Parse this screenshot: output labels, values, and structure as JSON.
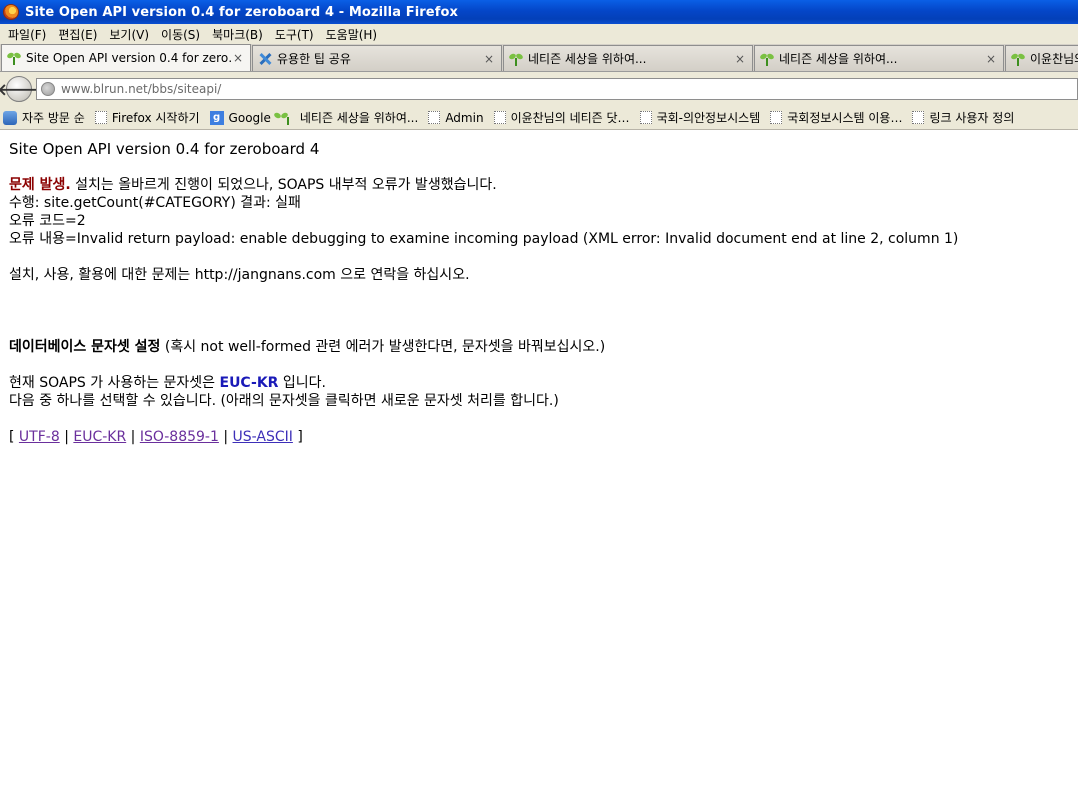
{
  "window": {
    "title": "Site Open API version 0.4 for zeroboard 4 - Mozilla Firefox"
  },
  "menu": [
    "파일(F)",
    "편집(E)",
    "보기(V)",
    "이동(S)",
    "북마크(B)",
    "도구(T)",
    "도움말(H)"
  ],
  "tabs": [
    {
      "label": "Site Open API version 0.4 for zero…",
      "icon": "sprout-icon",
      "close": "×",
      "active": true
    },
    {
      "label": "유용한 팁 공유",
      "icon": "x-icon",
      "close": "×",
      "active": false
    },
    {
      "label": "네티즌 세상을 위하여...",
      "icon": "sprout-icon",
      "close": "×",
      "active": false
    },
    {
      "label": "네티즌 세상을 위하여...",
      "icon": "sprout-icon",
      "close": "×",
      "active": false
    },
    {
      "label": "이윤찬님의",
      "icon": "sprout-icon",
      "close": "",
      "active": false
    }
  ],
  "navigation": {
    "url": "www.blrun.net/bbs/siteapi/",
    "back_glyph": "🡐"
  },
  "bookmarks": [
    {
      "label": "자주 방문 순",
      "icon": "magnifier-icon"
    },
    {
      "label": "Firefox 시작하기",
      "icon": "blank-page-icon"
    },
    {
      "label": "Google",
      "icon": "google-icon"
    },
    {
      "label": "네티즌 세상을 위하여...",
      "icon": "sprout-icon"
    },
    {
      "label": "Admin",
      "icon": "blank-page-icon"
    },
    {
      "label": "이윤찬님의 네티즌 닷…",
      "icon": "blank-page-icon"
    },
    {
      "label": "국회-의안정보시스템",
      "icon": "blank-page-icon"
    },
    {
      "label": "국회정보시스템 이용…",
      "icon": "blank-page-icon"
    },
    {
      "label": "링크 사용자 정의",
      "icon": "blank-page-icon"
    }
  ],
  "page": {
    "heading": "Site Open API version 0.4 for zeroboard 4",
    "problem_label": "문제 발생.",
    "problem_text": " 설치는 올바르게 진행이 되었으나, SOAPS 내부적 오류가 발생했습니다.",
    "action_line": "수행: site.getCount(#CATEGORY) 결과: 실패",
    "error_code_line": "오류 코드=2",
    "error_detail_line": "오류 내용=Invalid return payload: enable debugging to examine incoming payload (XML error: Invalid document end at line 2, column 1)",
    "contact_line": "설치, 사용, 활용에 대한 문제는 http://jangnans.com 으로 연락을 하십시오.",
    "charset_title": "데이터베이스 문자셋 설정",
    "charset_note": " (혹시 not well-formed 관련 에러가 발생한다면, 문자셋을 바꿔보십시오.)",
    "current_prefix": "현재 SOAPS 가 사용하는 문자셋은 ",
    "current_charset": "EUC-KR",
    "current_suffix": " 입니다.",
    "choose_line": "다음 중 하나를 선택할 수 있습니다. (아래의 문자셋을 클릭하면 새로운 문자셋 처리를 합니다.)",
    "bracket_open": "[",
    "separator": "|",
    "bracket_close": "]",
    "charset_options": [
      "UTF-8",
      "EUC-KR",
      "ISO-8859-1",
      "US-ASCII"
    ]
  },
  "colors": {
    "error_red": "#8b0000",
    "charset_blue": "#1a1ab8",
    "link": "#3d2fb8"
  }
}
